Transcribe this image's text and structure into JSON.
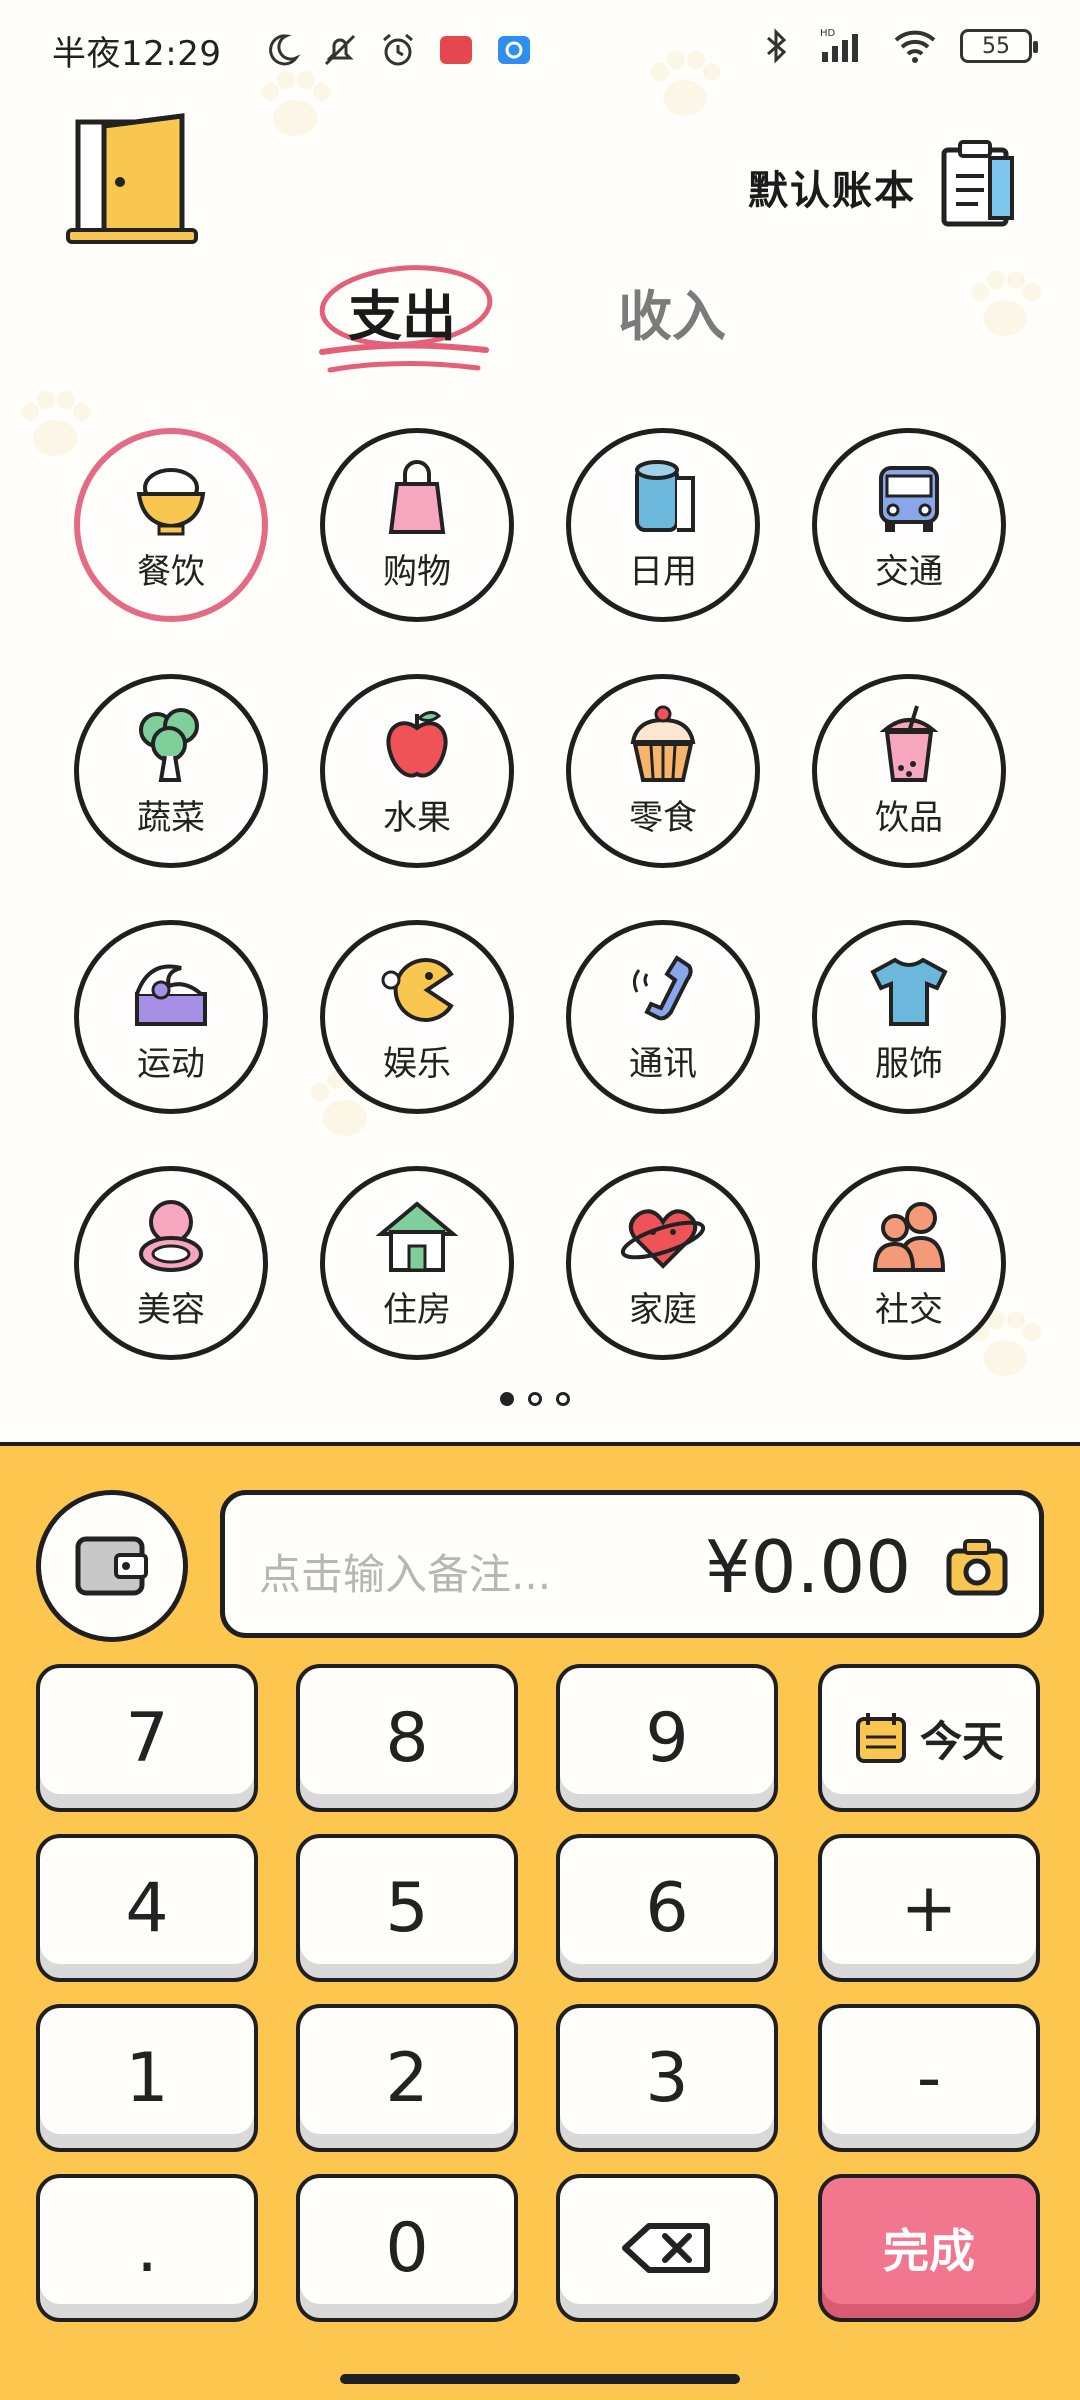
{
  "status_bar": {
    "time": "半夜12:29",
    "battery": "55",
    "icons": [
      "moon-icon",
      "mute-icon",
      "alarm-icon",
      "app-badge-red-icon",
      "app-badge-blue-icon",
      "bluetooth-icon",
      "signal-icon",
      "wifi-icon",
      "battery-icon"
    ]
  },
  "header": {
    "ledger_title": "默认账本",
    "exit_icon": "door-icon",
    "ledger_icon": "clipboard-icon"
  },
  "tabs": {
    "expense": "支出",
    "income": "收入",
    "active": "expense"
  },
  "categories": [
    {
      "label": "餐饮",
      "icon": "rice-bowl-icon",
      "selected": true
    },
    {
      "label": "购物",
      "icon": "shopping-bag-icon"
    },
    {
      "label": "日用",
      "icon": "toilet-paper-icon"
    },
    {
      "label": "交通",
      "icon": "bus-icon"
    },
    {
      "label": "蔬菜",
      "icon": "broccoli-icon"
    },
    {
      "label": "水果",
      "icon": "apple-icon"
    },
    {
      "label": "零食",
      "icon": "cupcake-icon"
    },
    {
      "label": "饮品",
      "icon": "bubble-tea-icon"
    },
    {
      "label": "运动",
      "icon": "swim-wave-icon"
    },
    {
      "label": "娱乐",
      "icon": "pacman-icon"
    },
    {
      "label": "通讯",
      "icon": "phone-icon"
    },
    {
      "label": "服饰",
      "icon": "tshirt-icon"
    },
    {
      "label": "美容",
      "icon": "compact-mirror-icon"
    },
    {
      "label": "住房",
      "icon": "house-icon"
    },
    {
      "label": "家庭",
      "icon": "heart-planet-icon"
    },
    {
      "label": "社交",
      "icon": "people-icon"
    }
  ],
  "pager": {
    "pages": 3,
    "active": 1
  },
  "entry": {
    "note_placeholder": "点击输入备注...",
    "amount": "¥0.00",
    "wallet_icon": "wallet-icon",
    "camera_icon": "camera-icon"
  },
  "keypad": {
    "k7": "7",
    "k8": "8",
    "k9": "9",
    "today": "今天",
    "k4": "4",
    "k5": "5",
    "k6": "6",
    "plus": "+",
    "k1": "1",
    "k2": "2",
    "k3": "3",
    "minus": "-",
    "dot": ".",
    "k0": "0",
    "backspace_icon": "backspace-icon",
    "done": "完成"
  },
  "colors": {
    "keypad_bg": "#fdc64f",
    "done_button": "#f3768f",
    "selected_ring": "#e46b85"
  }
}
